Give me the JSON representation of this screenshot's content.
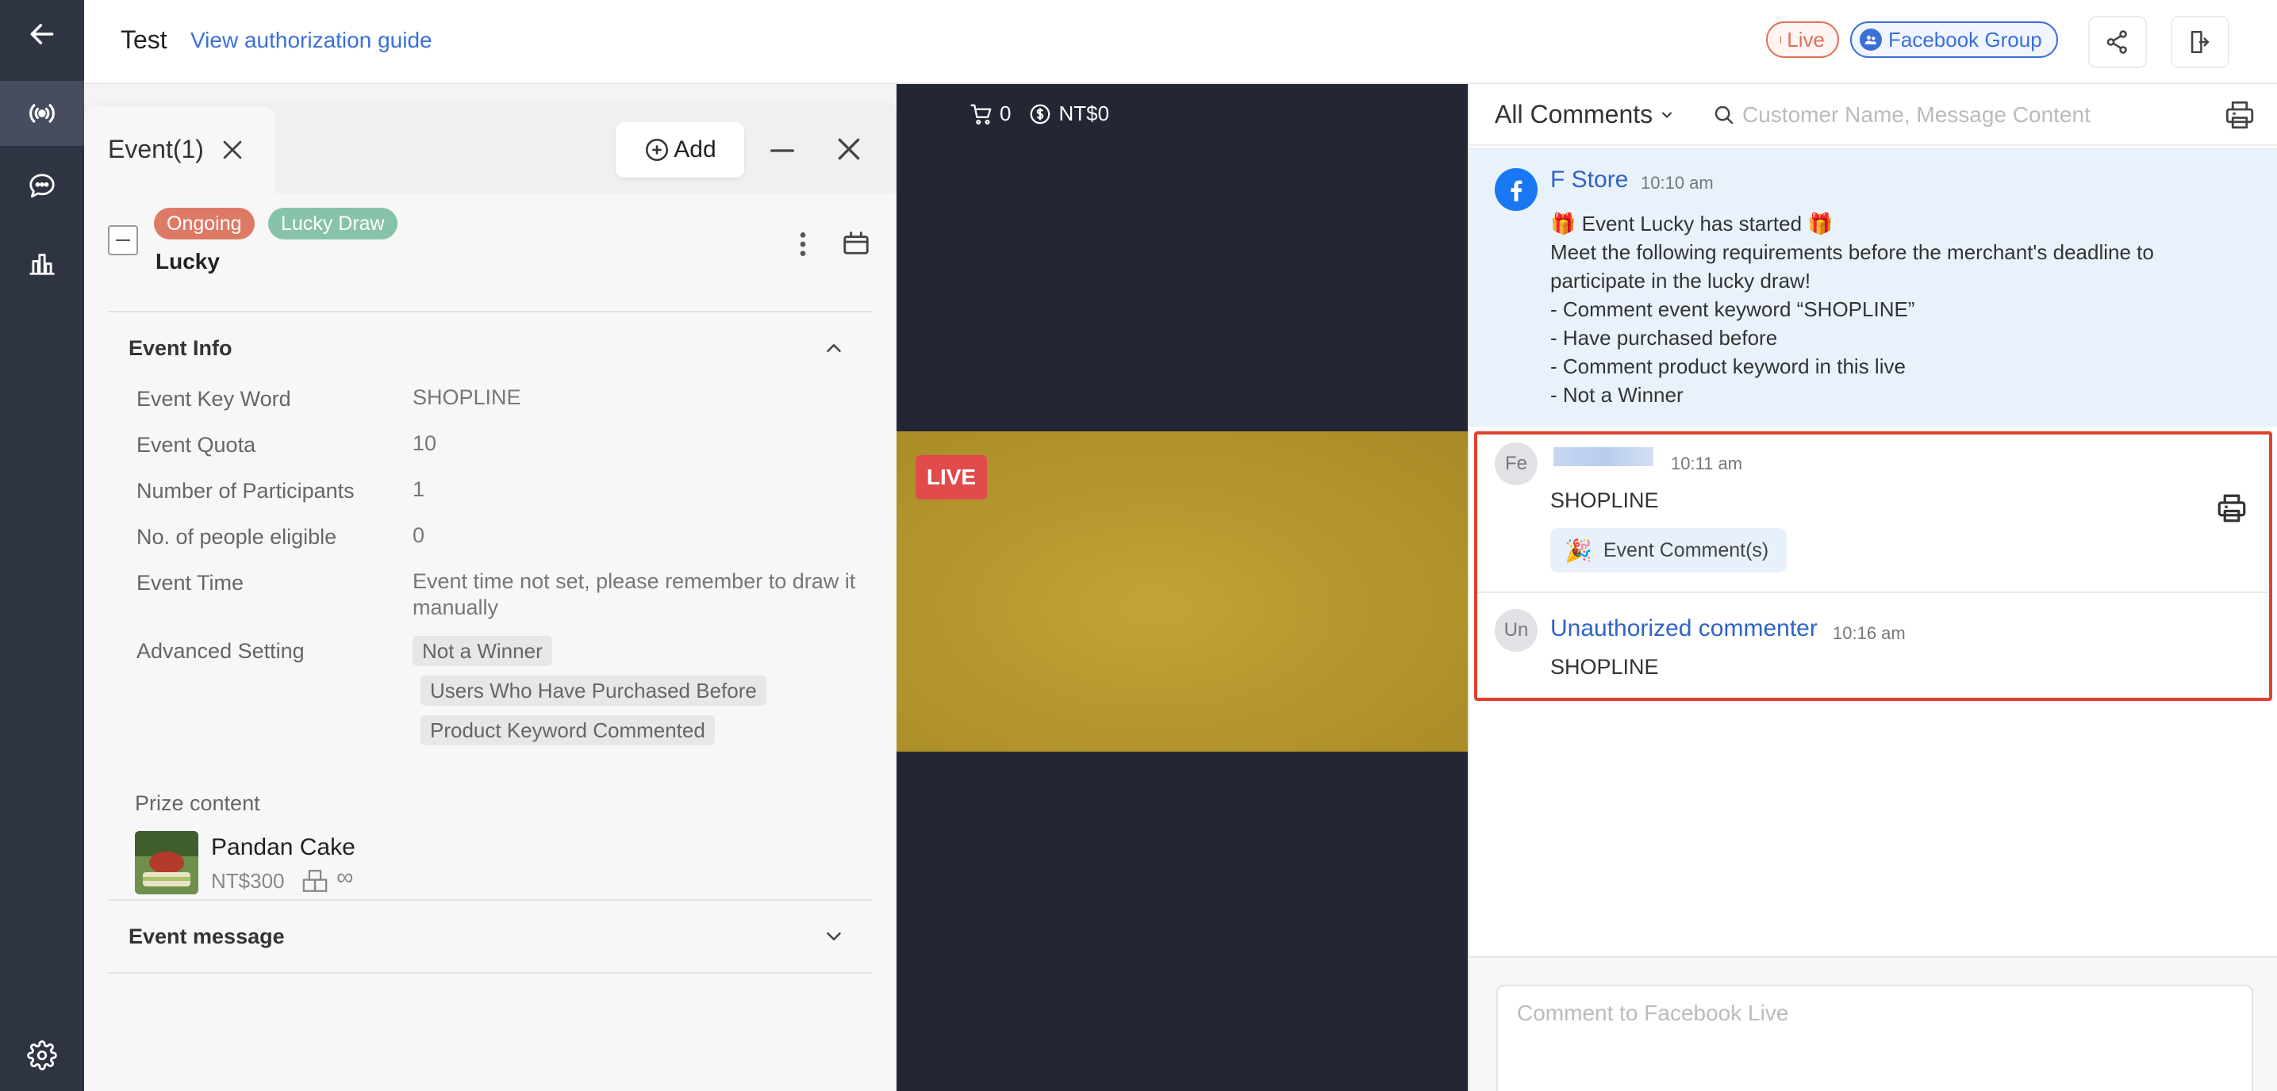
{
  "header": {
    "title": "Test",
    "guide_link": "View authorization guide",
    "live_chip": "Live",
    "group_chip": "Facebook Group"
  },
  "rail": {
    "icons": [
      "back-arrow-icon",
      "live-broadcast-icon",
      "chat-icon",
      "analytics-icon",
      "settings-icon"
    ],
    "active": "live-broadcast-icon"
  },
  "event_panel": {
    "tab_title": "Event(1)",
    "add_label": "Add",
    "event": {
      "status_badge": "Ongoing",
      "type_badge": "Lucky Draw",
      "name": "Lucky"
    },
    "event_info": {
      "title": "Event Info",
      "rows": [
        {
          "label": "Event Key Word",
          "value": "SHOPLINE"
        },
        {
          "label": "Event Quota",
          "value": "10"
        },
        {
          "label": "Number of Participants",
          "value": "1"
        },
        {
          "label": "No. of people eligible",
          "value": "0"
        },
        {
          "label": "Event Time",
          "value": "Event time not set, please remember to draw it manually"
        },
        {
          "label": "Advanced Setting",
          "value": ""
        }
      ],
      "advanced_tags": [
        "Not a Winner",
        "Users Who Have Purchased Before",
        "Product Keyword Commented"
      ],
      "prize_label": "Prize content",
      "prize": {
        "name": "Pandan Cake",
        "price": "NT$300",
        "stock": "∞"
      }
    },
    "event_message_title": "Event message"
  },
  "video": {
    "cart_count": "0",
    "revenue": "NT$0",
    "live_badge": "LIVE"
  },
  "comments": {
    "filter_label": "All Comments",
    "search_placeholder": "Customer Name, Message Content",
    "items": [
      {
        "author": "F Store",
        "time": "10:10 am",
        "text": "🎁 Event Lucky has started 🎁\nMeet the following requirements before the merchant's deadline to participate in the lucky draw!\n- Comment event keyword “SHOPLINE”\n- Have purchased before\n- Comment product keyword in this live\n- Not a Winner"
      },
      {
        "avatar": "Fe",
        "author": "",
        "time": "10:11 am",
        "text": "SHOPLINE",
        "chip": "Event Comment(s)"
      },
      {
        "avatar": "Un",
        "author": "Unauthorized commenter",
        "time": "10:16 am",
        "text": "SHOPLINE"
      }
    ],
    "input_placeholder": "Comment to Facebook Live"
  },
  "colors": {
    "rail_bg": "#2f3442",
    "accent_blue": "#3a6fd8",
    "live_red": "#e14b4b",
    "highlight_red": "#e0402e"
  }
}
